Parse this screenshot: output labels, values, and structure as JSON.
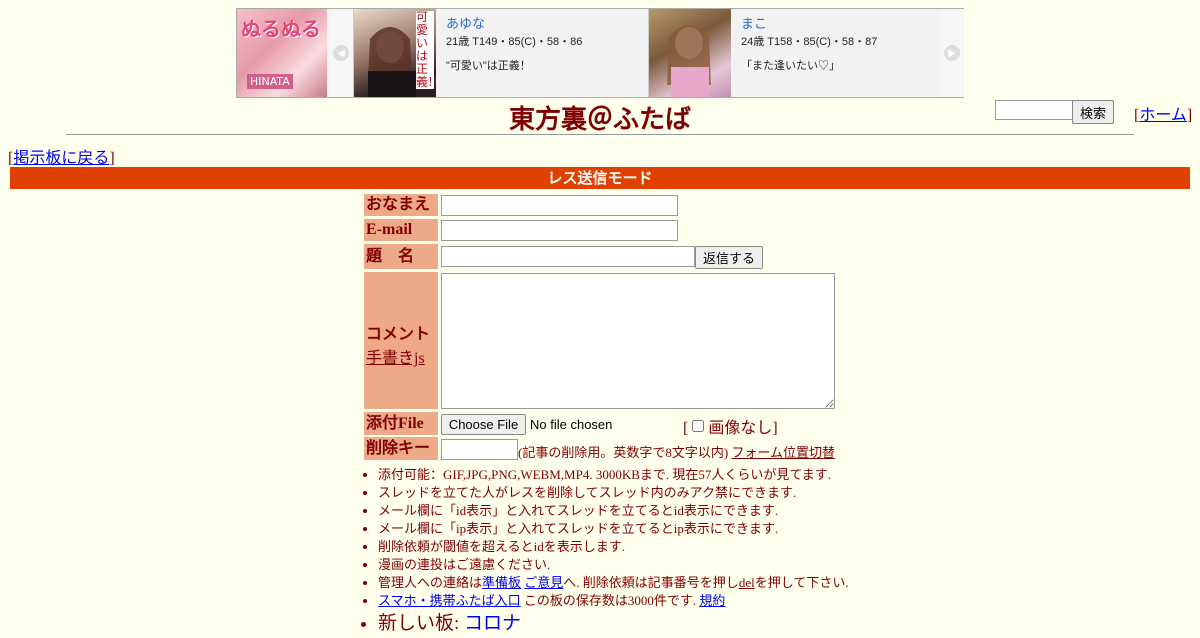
{
  "banner": {
    "left_ad": {
      "title": "ぬるぬる",
      "sub": "HINATA"
    },
    "prev_icon": "chevron-left-icon",
    "next_icon": "chevron-right-icon",
    "cards": [
      {
        "name": "あゆな",
        "stats": "21歳 T149・85(C)・58・86",
        "message": "\"可愛い\"は正義！",
        "photo_text": "可愛いは正義!!"
      },
      {
        "name": "まこ",
        "stats": "24歳 T158・85(C)・58・87",
        "message": "「また逢いたい♡」"
      }
    ]
  },
  "header": {
    "title": "東方裏＠ふたば",
    "search_button": "検索",
    "home_link": "ホーム",
    "back_link": "掲示板に戻る"
  },
  "form": {
    "mode_title": "レス送信モード",
    "name_label": "おなまえ",
    "email_label": "E-mail",
    "subject_label": "題　名",
    "submit_label": "返信する",
    "comment_label": "コメント",
    "tegaki_link": "手書きjs",
    "file_label": "添付File",
    "choose_file": "Choose File",
    "no_file": "No file chosen",
    "no_image_label": "画像なし",
    "delkey_label": "削除キー",
    "delkey_note": "(記事の削除用。英数字で8文字以内)",
    "form_toggle_link": "フォーム位置切替"
  },
  "rules": {
    "r1": "添付可能：GIF,JPG,PNG,WEBM,MP4. 3000KBまで. 現在57人くらいが見てます.",
    "r2": "スレッドを立てた人がレスを削除してスレッド内のみアク禁にできます.",
    "r3": "メール欄に「id表示」と入れてスレッドを立てるとid表示にできます.",
    "r4": "メール欄に「ip表示」と入れてスレッドを立てるとip表示にできます.",
    "r5": "削除依頼が閾値を超えるとidを表示します.",
    "r6": "漫画の連投はご遠慮ください.",
    "r7_pre": "管理人への連絡は",
    "r7_link1": "準備板",
    "r7_link2": "ご意見",
    "r7_mid": "へ. 削除依頼は記事番号を押し",
    "r7_link3": "del",
    "r7_post": "を押して下さい.",
    "r8_link": "スマホ・携帯ふたば入口",
    "r8_text": " この板の保存数は3000件です. ",
    "r8_link2": "規約",
    "r9_pre": "新しい板: ",
    "r9_link": "コロナ"
  }
}
